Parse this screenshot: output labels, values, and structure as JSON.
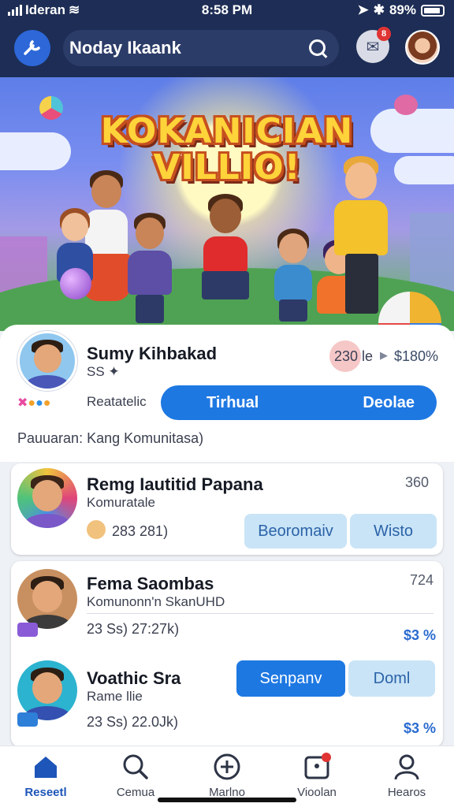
{
  "status_bar": {
    "carrier": "Ideran",
    "time": "8:58 PM",
    "battery": "89%"
  },
  "header": {
    "search": {
      "value": "Noday Ikaank",
      "placeholder": "Noday Ikaank"
    },
    "notification_count": "8"
  },
  "banner": {
    "title_line1": "KOKANICIAN",
    "title_line2": "VILLIO!"
  },
  "profile_card": {
    "name": "Sumy Kihbakad",
    "sub": "SS",
    "count": "230 le",
    "amount": "$180%",
    "category": "Reatatelic",
    "pill_left": "Tirhual",
    "pill_right": "Deolae",
    "community_label": "Pauuaran:",
    "community_value": "Kang Komunitasa)"
  },
  "featured_item": {
    "title": "Remg Iautitid Papana",
    "subtitle": "Komuratale",
    "stats": "283 281)",
    "count": "360",
    "btn1": "Beoromaiv",
    "btn2": "Wisto"
  },
  "list_items": [
    {
      "name": "Fema Saombas",
      "subtitle": "Komunonn'n SkanUHD",
      "stats": "23 Ss) 27:27k)",
      "count": "724",
      "amount": "$3 %"
    },
    {
      "name": "Voathic Sra",
      "subtitle": "Rame llie",
      "stats": "23 Ss) 22.0Jk)",
      "amount": "$3 %",
      "btn_primary": "Senpanv",
      "btn_secondary": "Doml"
    }
  ],
  "bottom_nav": [
    {
      "label": "Reseetl",
      "icon": "home-icon",
      "active": true
    },
    {
      "label": "Cemua",
      "icon": "search-icon",
      "active": false
    },
    {
      "label": "Marlno",
      "icon": "compass-icon",
      "active": false
    },
    {
      "label": "Vioolan",
      "icon": "notification-icon",
      "active": false
    },
    {
      "label": "Hearos",
      "icon": "profile-icon",
      "active": false
    }
  ],
  "colors": {
    "header_bg": "#1d2d55",
    "accent": "#1e78e2",
    "light_button": "#c9e4f7",
    "badge": "#e03434"
  }
}
